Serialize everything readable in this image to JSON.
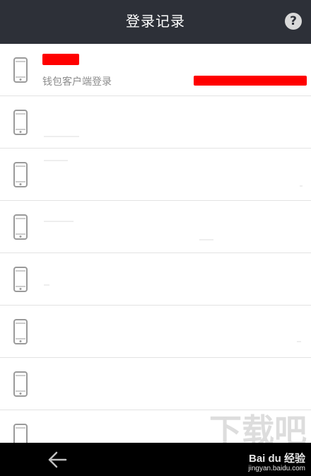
{
  "header": {
    "title": "登录记录",
    "help_label": "?",
    "background": "#2d3038"
  },
  "list": {
    "rows": [
      {
        "icon": "phone-icon",
        "title": "",
        "subtitle": "钱包客户端登录",
        "title_redacted": true,
        "right_redacted": true
      },
      {
        "icon": "phone-icon",
        "title": "",
        "subtitle": ""
      },
      {
        "icon": "phone-icon",
        "title": "",
        "subtitle": ""
      },
      {
        "icon": "phone-icon",
        "title": "",
        "subtitle": ""
      },
      {
        "icon": "phone-icon",
        "title": "",
        "subtitle": ""
      },
      {
        "icon": "phone-icon",
        "title": "",
        "subtitle": ""
      },
      {
        "icon": "phone-icon",
        "title": "",
        "subtitle": ""
      },
      {
        "icon": "phone-icon",
        "title": "",
        "subtitle": ""
      }
    ]
  },
  "bottom_bar": {
    "back_icon": "arrow-left-icon"
  },
  "watermark": {
    "brand": "Bai du 经验",
    "url": "jingyan.baidu.com",
    "logo_text": "下载吧"
  },
  "colors": {
    "redaction": "#ff0000",
    "subtitle": "#8c8c8c",
    "divider": "#e3e3e3"
  }
}
